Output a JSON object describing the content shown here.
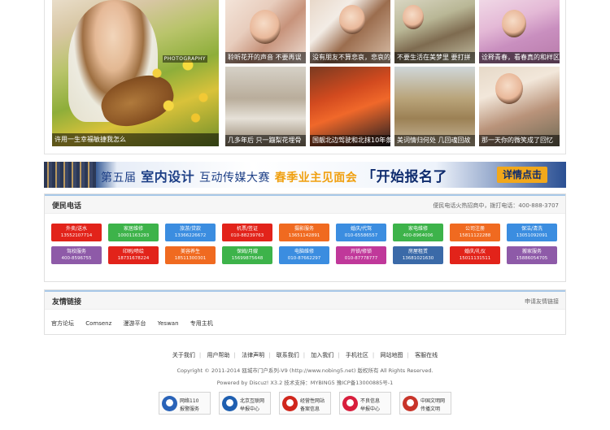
{
  "gallery": {
    "big": {
      "caption": "许用一生幸福敏捷我怎么",
      "watermark": "PHOTOGRAPHY"
    },
    "thumbs": [
      {
        "caption": "聆听花开的声音 不要再误"
      },
      {
        "caption": "没有朋友不算悲哀，悲哀的"
      },
      {
        "caption": "不要生活在美梦里 要打拼"
      },
      {
        "caption": "诠释青春，看春真的和样区"
      },
      {
        "caption": "几多年后 只一蹦梨花埋骨"
      },
      {
        "caption": "国靓北边驾驶和北抹10年条件"
      },
      {
        "caption": "美词情归何处 几回魂回故"
      },
      {
        "caption": "那一天你的微笑成了回忆"
      }
    ]
  },
  "banner": {
    "part_a": "第五届",
    "part_b": "室内设计",
    "part_c": "互动传媒大赛",
    "part_d": "春季业主见面会",
    "part_e": "「开始报名了",
    "cta": "详情点击"
  },
  "phone_panel": {
    "title": "便民电话",
    "side": "便民电话火热招商中，拨打电话：400-888-3707",
    "rows": [
      [
        {
          "name": "外卖/送水",
          "phone": "13552107714",
          "color": "#e2231a"
        },
        {
          "name": "家居维修",
          "phone": "10001163293",
          "color": "#3db34a"
        },
        {
          "name": "旅游/贷款",
          "phone": "13366226672",
          "color": "#3b8de0"
        },
        {
          "name": "机票/签证",
          "phone": "010-88239763",
          "color": "#e2231a"
        },
        {
          "name": "摄影服务",
          "phone": "13651142891",
          "color": "#f06a20"
        },
        {
          "name": "婚庆/代驾",
          "phone": "010-65586557",
          "color": "#3b8de0"
        },
        {
          "name": "家电维修",
          "phone": "400-8964006",
          "color": "#3db34a"
        },
        {
          "name": "公司注册",
          "phone": "15811122288",
          "color": "#f06a20"
        },
        {
          "name": "保洁/清洗",
          "phone": "13051092091",
          "color": "#3b8de0"
        }
      ],
      [
        {
          "name": "驾校服务",
          "phone": "400-8596755",
          "color": "#8e5aa8"
        },
        {
          "name": "印刷/喷绘",
          "phone": "18731678224",
          "color": "#e2231a"
        },
        {
          "name": "美容养生",
          "phone": "18511300301",
          "color": "#f06a20"
        },
        {
          "name": "保姆/月嫂",
          "phone": "15699875648",
          "color": "#3db34a"
        },
        {
          "name": "电脑维修",
          "phone": "010-87662297",
          "color": "#3b8de0"
        },
        {
          "name": "开锁/修锁",
          "phone": "010-87778777",
          "color": "#c0389a"
        },
        {
          "name": "房屋租赁",
          "phone": "13681021630",
          "color": "#3b6aa8"
        },
        {
          "name": "婚庆/礼仪",
          "phone": "15011131511",
          "color": "#e2231a"
        },
        {
          "name": "搬家服务",
          "phone": "15886054705",
          "color": "#8e5aa8"
        }
      ]
    ]
  },
  "links_panel": {
    "title": "友情链接",
    "side": "申请友情链接",
    "items": [
      "官方论坛",
      "Comsenz",
      "漫游平台",
      "Yeswan",
      "专用主机"
    ]
  },
  "footer": {
    "nav": [
      "关于我们",
      "用户帮助",
      "法律声明",
      "联系我们",
      "加入我们",
      "手机社区",
      "网站地图",
      "客服在线"
    ],
    "copyright": "Copyright © 2011-2014 瓯城市门户系列-V9 (http://www.nobing5.net) 版权所有 All Rights Reserved.",
    "powered": "Powered by Discuz! X3.2 技术支持：MYBING5 豫ICP备13000885号-1",
    "badges": [
      {
        "line1": "网络110",
        "line2": "报警服务",
        "color": "#2a63b8"
      },
      {
        "line1": "北京互联网",
        "line2": "举报中心",
        "color": "#1f5fb0"
      },
      {
        "line1": "经营性网站",
        "line2": "备案信息",
        "color": "#d0261c"
      },
      {
        "line1": "不良信息",
        "line2": "举报中心",
        "color": "#d81e3c"
      },
      {
        "line1": "中国文明网",
        "line2": "传播文明",
        "color": "#c8342a"
      }
    ]
  }
}
